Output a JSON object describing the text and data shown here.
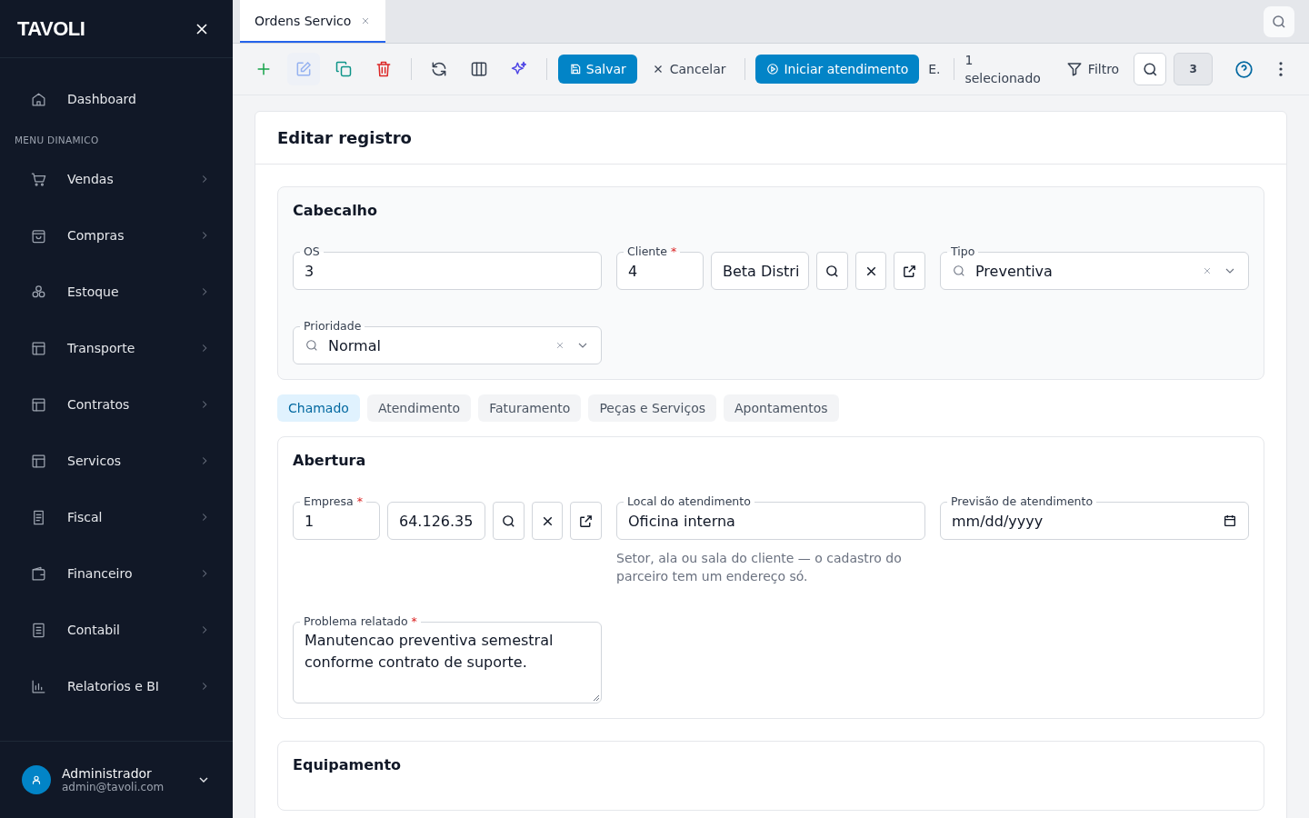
{
  "sidebar": {
    "logo": "TAVOLI",
    "home": {
      "label": "Dashboard"
    },
    "section_title": "MENU DINAMICO",
    "items": [
      {
        "label": "Vendas"
      },
      {
        "label": "Compras"
      },
      {
        "label": "Estoque"
      },
      {
        "label": "Transporte"
      },
      {
        "label": "Contratos"
      },
      {
        "label": "Servicos"
      },
      {
        "label": "Fiscal"
      },
      {
        "label": "Financeiro"
      },
      {
        "label": "Contabil"
      },
      {
        "label": "Relatorios e BI"
      }
    ],
    "user": {
      "name": "Administrador",
      "email": "admin@tavoli.com"
    }
  },
  "tabs": [
    {
      "label": "Ordens Servico",
      "selected": true
    }
  ],
  "toolbar": {
    "icon_groups": [
      [
        {
          "kind": "add",
          "disabled": false
        },
        {
          "kind": "edit",
          "disabled": true
        },
        {
          "kind": "copy",
          "disabled": false
        },
        {
          "kind": "delete",
          "disabled": false
        }
      ],
      [
        {
          "kind": "refresh",
          "disabled": false
        },
        {
          "kind": "columns",
          "disabled": false
        },
        {
          "kind": "sparkle",
          "disabled": false
        }
      ]
    ],
    "save": "Salvar",
    "cancel": "Cancelar",
    "action": "Iniciar atendimento",
    "extra": "E.",
    "selection": "1 selecionado",
    "filter": "Filtro",
    "count": "3"
  },
  "form": {
    "title": "Editar registro",
    "required_marker": "*",
    "header_section": {
      "title": "Cabecalho",
      "fields": [
        {
          "kind": "text",
          "label": "OS",
          "required": false,
          "value": "3"
        },
        {
          "kind": "lookup",
          "label": "Cliente",
          "required": true,
          "value": "4",
          "name": "Beta Distri"
        },
        {
          "kind": "select",
          "label": "Tipo",
          "required": false,
          "value": "Preventiva"
        },
        {
          "kind": "select",
          "label": "Prioridade",
          "required": false,
          "value": "Normal"
        }
      ]
    },
    "subtabs": [
      {
        "label": "Chamado",
        "selected": true
      },
      {
        "label": "Atendimento",
        "selected": false
      },
      {
        "label": "Faturamento",
        "selected": false
      },
      {
        "label": "Peças e Serviços",
        "selected": false
      },
      {
        "label": "Apontamentos",
        "selected": false
      }
    ],
    "sections": [
      {
        "title": "Abertura",
        "fields": [
          {
            "kind": "lookup",
            "label": "Empresa",
            "required": true,
            "value": "1",
            "name": "64.126.35"
          },
          {
            "kind": "text",
            "label": "Local do atendimento",
            "required": false,
            "value": "Oficina interna",
            "help": "Setor, ala ou sala do cliente — o cadastro do parceiro tem um endereço só."
          },
          {
            "kind": "date",
            "label": "Previsão de atendimento",
            "required": false,
            "placeholder": "mm/dd/yyyy"
          },
          {
            "kind": "textarea",
            "label": "Problema relatado",
            "required": true,
            "value": "Manutencao preventiva semestral conforme contrato de suporte."
          }
        ]
      },
      {
        "title": "Equipamento"
      }
    ]
  }
}
